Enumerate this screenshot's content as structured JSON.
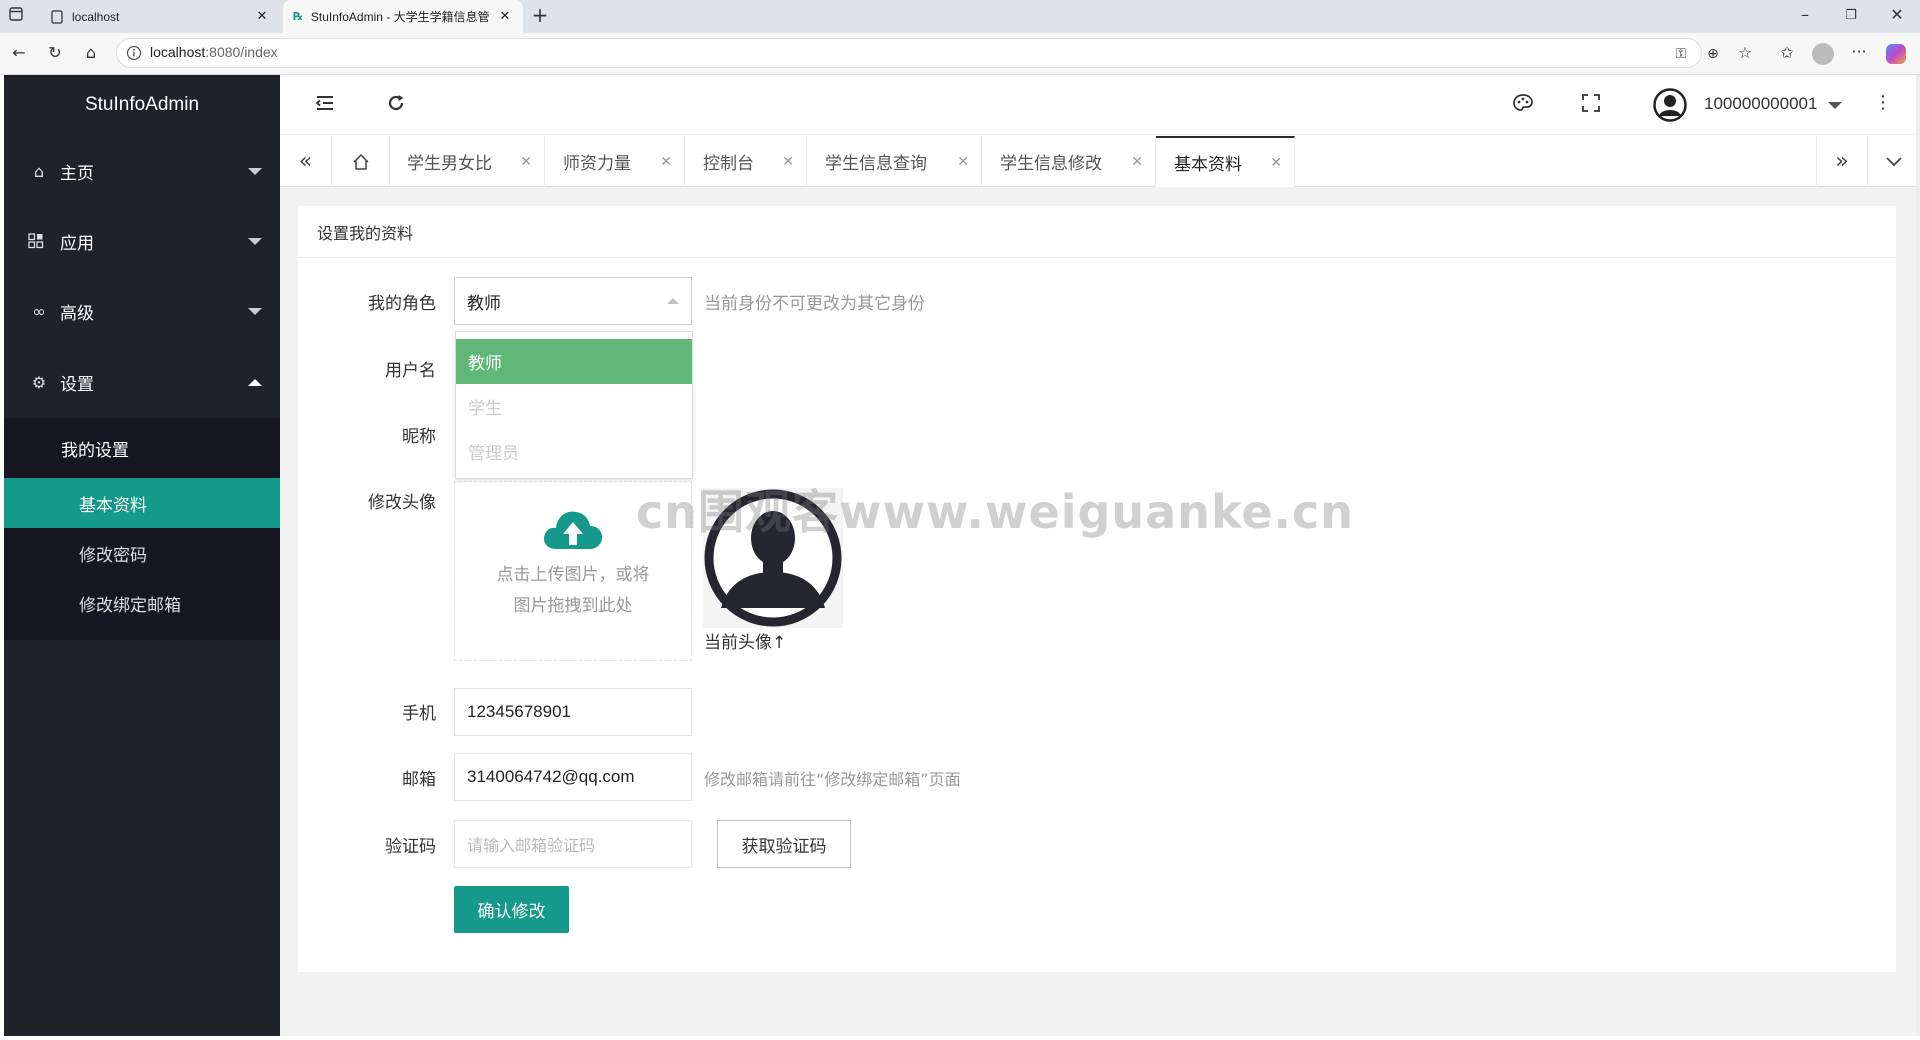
{
  "browser": {
    "tabs": [
      {
        "label": "localhost",
        "close": "✕"
      },
      {
        "label": "StuInfoAdmin - 大学生学籍信息管",
        "close": "✕"
      }
    ],
    "new_tab": "+",
    "url_host": "localhost",
    "url_rest": ":8080/index"
  },
  "app": {
    "logo": "StuInfoAdmin",
    "user": {
      "name": "100000000001"
    }
  },
  "sidebar": {
    "items": [
      {
        "label": "主页",
        "icon": "home-icon"
      },
      {
        "label": "应用",
        "icon": "apps-icon"
      },
      {
        "label": "高级",
        "icon": "infinity-icon"
      },
      {
        "label": "设置",
        "icon": "gear-icon"
      }
    ],
    "submenu_parent": "我的设置",
    "submenu": [
      {
        "label": "基本资料",
        "active": true
      },
      {
        "label": "修改密码",
        "active": false
      },
      {
        "label": "修改绑定邮箱",
        "active": false
      }
    ]
  },
  "page_tabs": [
    {
      "label": "学生男女比"
    },
    {
      "label": "师资力量"
    },
    {
      "label": "控制台"
    },
    {
      "label": "学生信息查询"
    },
    {
      "label": "学生信息修改"
    },
    {
      "label": "基本资料",
      "active": true
    }
  ],
  "card": {
    "title": "设置我的资料"
  },
  "form": {
    "role_label": "我的角色",
    "role_value": "教师",
    "role_hint": "当前身份不可更改为其它身份",
    "role_options": [
      "教师",
      "学生",
      "管理员"
    ],
    "username_label": "用户名",
    "nickname_label": "昵称",
    "avatar_label": "修改头像",
    "upload_text_1": "点击上传图片，或将",
    "upload_text_2": "图片拖拽到此处",
    "avatar_caption": "当前头像↑",
    "phone_label": "手机",
    "phone_value": "12345678901",
    "email_label": "邮箱",
    "email_value": "3140064742@qq.com",
    "email_hint": "修改邮箱请前往“修改绑定邮箱”页面",
    "code_label": "验证码",
    "code_placeholder": "请输入邮箱验证码",
    "get_code_button": "获取验证码",
    "submit_button": "确认修改"
  },
  "watermark": "cn围观客www.weiguanke.cn",
  "colors": {
    "sidebar_bg": "#20222a",
    "accent": "#15998a",
    "selected_option": "#5fb878"
  }
}
